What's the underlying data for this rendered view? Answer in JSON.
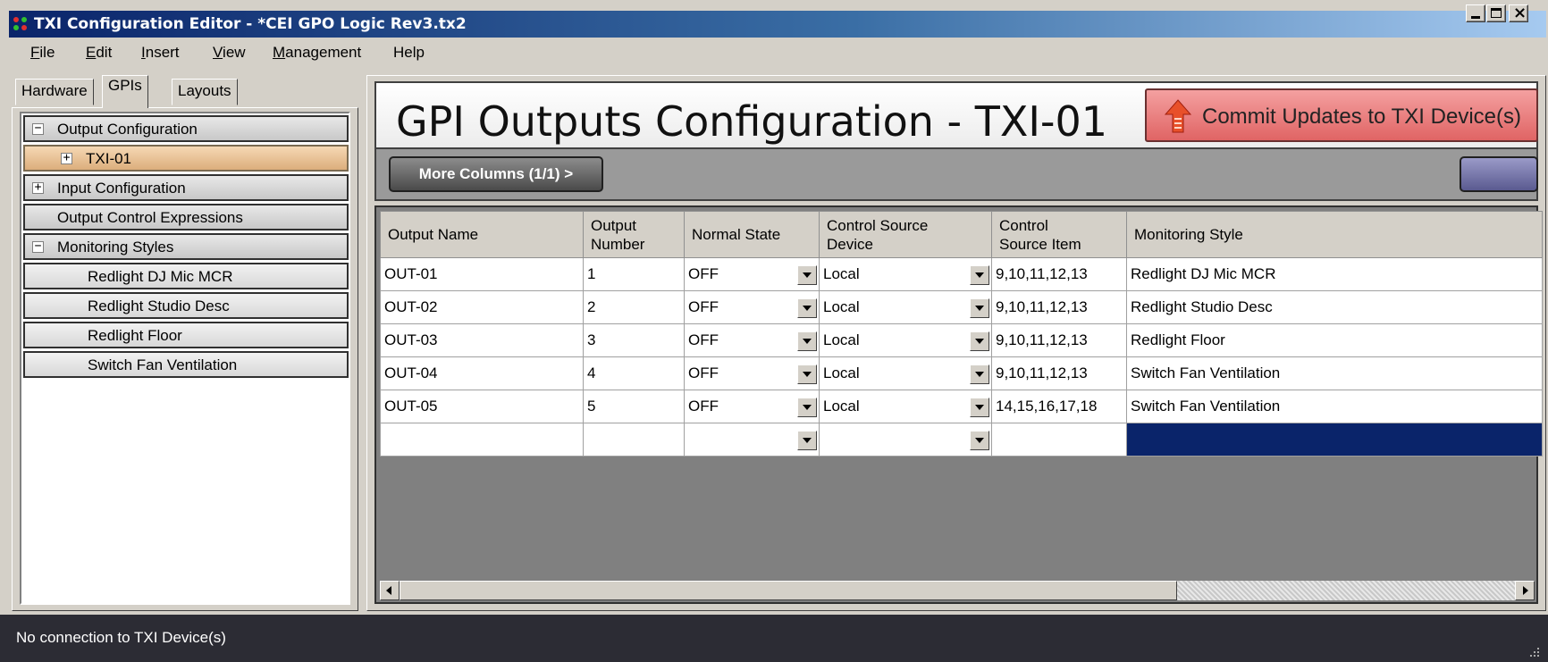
{
  "window": {
    "title": "TXI Configuration Editor - *CEI GPO Logic Rev3.tx2",
    "controls": [
      "minimize",
      "maximize",
      "close"
    ]
  },
  "menu": {
    "items": [
      {
        "mnemonic": "F",
        "rest": "ile"
      },
      {
        "mnemonic": "E",
        "rest": "dit"
      },
      {
        "mnemonic": "I",
        "rest": "nsert"
      },
      {
        "mnemonic": "V",
        "rest": "iew"
      },
      {
        "mnemonic": "M",
        "rest": "anagement"
      },
      {
        "mnemonic": "",
        "rest": "Help"
      }
    ]
  },
  "left_tabs": {
    "items": [
      "Hardware",
      "GPIs",
      "Layouts"
    ],
    "active": "GPIs"
  },
  "tree": {
    "items": [
      {
        "label": "Output Configuration",
        "expander": "−"
      },
      {
        "label": "TXI-01",
        "expander": "+"
      },
      {
        "label": "Input Configuration",
        "expander": "+"
      },
      {
        "label": "Output Control Expressions"
      },
      {
        "label": "Monitoring Styles",
        "expander": "−"
      },
      {
        "label": "Redlight DJ Mic MCR"
      },
      {
        "label": "Redlight Studio Desc"
      },
      {
        "label": "Redlight Floor"
      },
      {
        "label": "Switch Fan Ventilation"
      }
    ],
    "selected": "TXI-01"
  },
  "header": {
    "title": "GPI Outputs Configuration - TXI-01",
    "commit_label": "Commit Updates to TXI Device(s)"
  },
  "toolbar": {
    "more_columns_label": "More Columns (1/1) >"
  },
  "grid": {
    "columns": [
      {
        "l1": "Output Name",
        "l2": ""
      },
      {
        "l1": "Output",
        "l2": "Number"
      },
      {
        "l1": "Normal State",
        "l2": ""
      },
      {
        "l1": "Control Source",
        "l2": "Device"
      },
      {
        "l1": "Control",
        "l2": "Source Item"
      },
      {
        "l1": "Monitoring Style",
        "l2": ""
      }
    ],
    "rows": [
      [
        "OUT-01",
        "1",
        "OFF",
        "Local",
        "9,10,11,12,13",
        "Redlight DJ Mic MCR"
      ],
      [
        "OUT-02",
        "2",
        "OFF",
        "Local",
        "9,10,11,12,13",
        "Redlight Studio Desc"
      ],
      [
        "OUT-03",
        "3",
        "OFF",
        "Local",
        "9,10,11,12,13",
        "Redlight Floor"
      ],
      [
        "OUT-04",
        "4",
        "OFF",
        "Local",
        "9,10,11,12,13",
        "Switch Fan Ventilation"
      ],
      [
        "OUT-05",
        "5",
        "OFF",
        "Local",
        "14,15,16,17,18",
        "Switch Fan Ventilation"
      ],
      [
        "",
        "",
        "",
        "",
        "",
        ""
      ]
    ]
  },
  "status": {
    "text": "No connection to TXI Device(s)"
  },
  "colors": {
    "titlebar_start": "#0a246a",
    "commit_button": "#e06464",
    "selected_cell": "#0a246a",
    "status_bar": "#2c2c34",
    "tree_selected": "#dcae7c"
  }
}
